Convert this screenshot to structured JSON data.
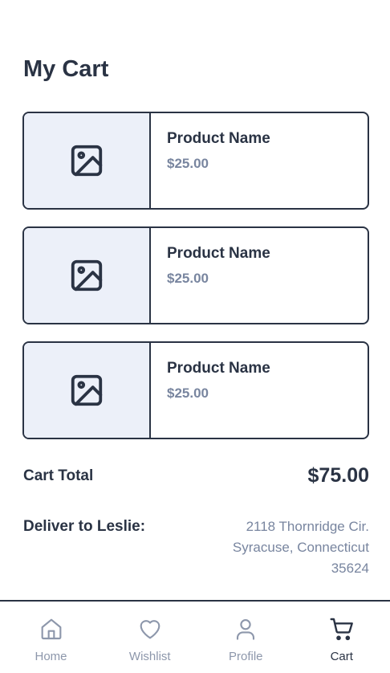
{
  "page": {
    "title": "My Cart"
  },
  "cart": {
    "items": [
      {
        "name": "Product Name",
        "price": "$25.00",
        "image_icon": "image-icon"
      },
      {
        "name": "Product Name",
        "price": "$25.00",
        "image_icon": "image-icon"
      },
      {
        "name": "Product Name",
        "price": "$25.00",
        "image_icon": "image-icon"
      }
    ]
  },
  "summary": {
    "total_label": "Cart Total",
    "total_value": "$75.00",
    "deliver_label": "Deliver to Leslie:",
    "address": [
      "2118 Thornridge Cir.",
      "Syracuse, Connecticut",
      "35624"
    ]
  },
  "tabs": [
    {
      "label": "Home",
      "icon": "home-icon",
      "active": false
    },
    {
      "label": "Wishlist",
      "icon": "heart-icon",
      "active": false
    },
    {
      "label": "Profile",
      "icon": "user-icon",
      "active": false
    },
    {
      "label": "Cart",
      "icon": "cart-icon",
      "active": true
    }
  ],
  "colors": {
    "text_dark": "#2a3344",
    "text_muted": "#78859f",
    "thumb_bg": "#ecf0f9",
    "tab_inactive": "#8d97ab"
  }
}
